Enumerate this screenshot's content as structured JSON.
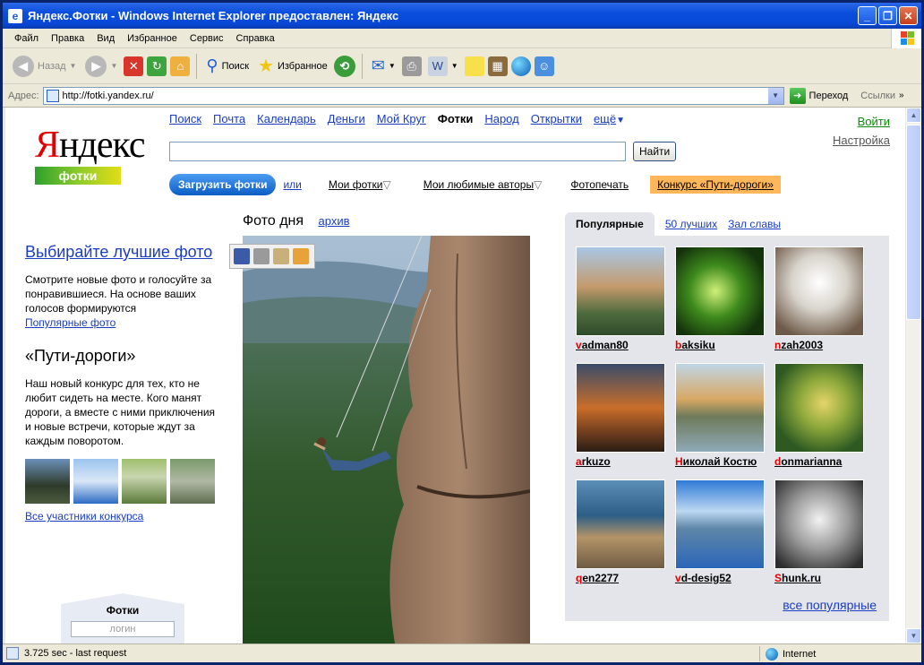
{
  "window": {
    "title": "Яндекс.Фотки - Windows Internet Explorer предоставлен: Яндекс"
  },
  "menu": [
    "Файл",
    "Правка",
    "Вид",
    "Избранное",
    "Сервис",
    "Справка"
  ],
  "toolbar": {
    "back": "Назад",
    "search": "Поиск",
    "favorites": "Избранное"
  },
  "address": {
    "label": "Адрес:",
    "url": "http://fotki.yandex.ru/",
    "go": "Переход",
    "links": "Ссылки"
  },
  "status": {
    "text": "3.725 sec - last request",
    "zone": "Internet"
  },
  "page": {
    "logo": {
      "ya": "Яндекс",
      "fotki": "фотки"
    },
    "nav": [
      "Поиск",
      "Почта",
      "Календарь",
      "Деньги",
      "Мой Круг",
      "Фотки",
      "Народ",
      "Открытки",
      "ещё"
    ],
    "login": "Войти",
    "settings": "Настройка",
    "search_button": "Найти",
    "upload": "Загрузить фотки",
    "or": "или",
    "my_photos": "Мои фотки",
    "fav_authors": "Мои любимые авторы",
    "photoprint": "Фотопечать",
    "contest": "Конкурс «Пути-дороги»",
    "left": {
      "heading": "Выбирайте лучшие фото",
      "text": "Смотрите новые фото и голосуйте за понравившиеся. На основе ваших голосов формируются",
      "popular_link": "Популярные фото",
      "contest_heading": "«Пути-дороги»",
      "contest_text": "Наш новый конкурс для тех, кто не любит сидеть на месте. Кого манят дороги, а вместе с ними приключения и новые встречи, которые ждут за каждым поворотом.",
      "all_participants": "Все участники конкурса",
      "login_box_title": "Фотки",
      "login_placeholder": "логин"
    },
    "photo_of_day": "Фото дня",
    "archive": "архив",
    "tabs": {
      "popular": "Популярные",
      "best50": "50 лучших",
      "hall": "Зал славы"
    },
    "popular": [
      {
        "name": "vadman80"
      },
      {
        "name": "baksiku"
      },
      {
        "name": "nzah2003"
      },
      {
        "name": "arkuzo"
      },
      {
        "name": "Николай Костю"
      },
      {
        "name": "donmarianna"
      },
      {
        "name": "qen2277"
      },
      {
        "name": "vd-desig52"
      },
      {
        "name": "Shunk.ru"
      }
    ],
    "all_popular": "все популярные"
  }
}
